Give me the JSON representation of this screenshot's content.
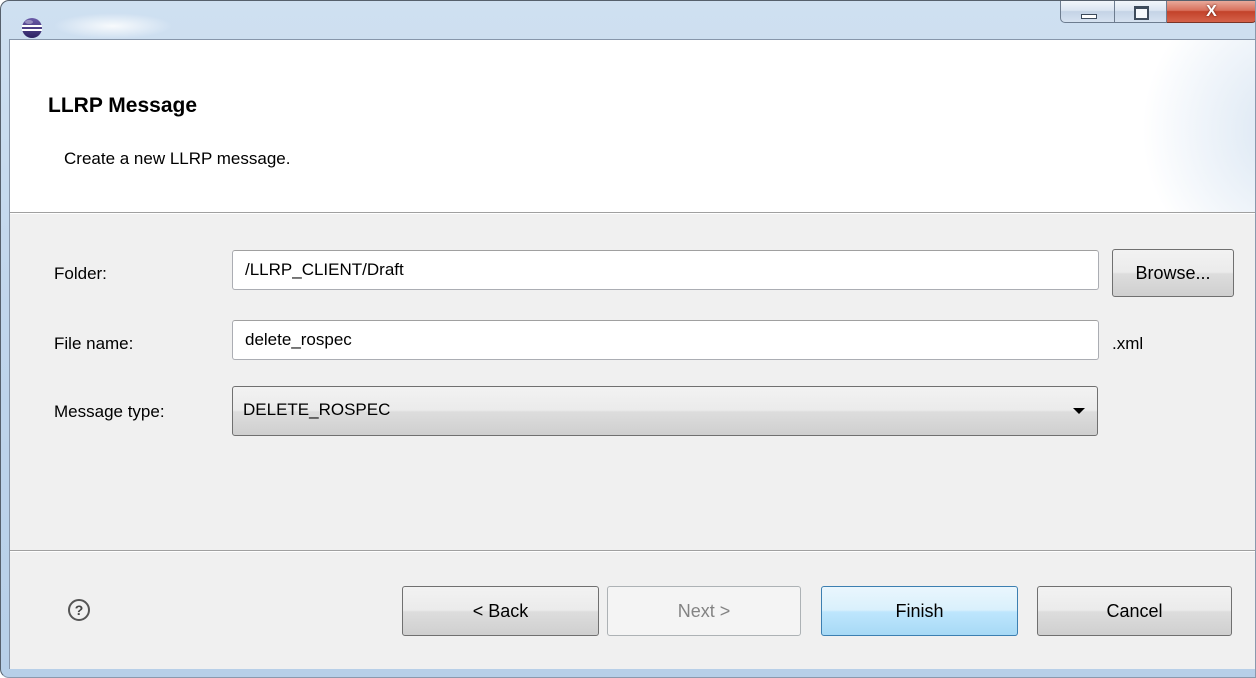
{
  "header": {
    "title": "LLRP Message",
    "description": "Create a new LLRP message."
  },
  "window": {
    "minimize_label": "",
    "maximize_label": "",
    "close_label": "X"
  },
  "form": {
    "folder_label": "Folder:",
    "folder_value": "/LLRP_CLIENT/Draft",
    "browse_label": "Browse...",
    "file_name_label": "File name:",
    "file_name_value": "delete_rospec",
    "file_extension": ".xml",
    "message_type_label": "Message type:",
    "message_type_value": "DELETE_ROSPEC"
  },
  "footer": {
    "help_icon": "question-circle-icon",
    "help_glyph": "?",
    "back_label": "< Back",
    "next_label": "Next >",
    "finish_label": "Finish",
    "cancel_label": "Cancel"
  }
}
